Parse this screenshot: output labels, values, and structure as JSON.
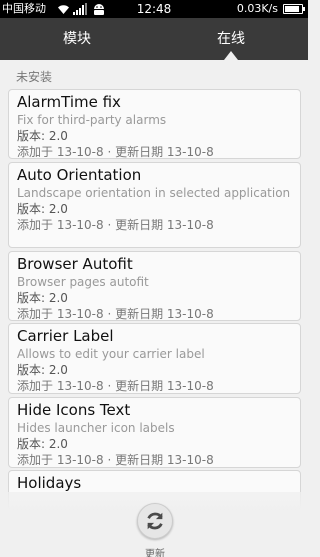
{
  "status_bar": {
    "carrier": "中国移动",
    "time": "12:48",
    "speed": "0.03K/s",
    "battery_level": 0.85
  },
  "tabs": [
    {
      "label": "模块"
    },
    {
      "label": "在线"
    }
  ],
  "section": {
    "title": "未安装"
  },
  "modules": [
    {
      "title": "AlarmTime fix",
      "description": "Fix for third-party alarms",
      "version": "版本: 2.0",
      "dates": "添加于 13-10-8 · 更新日期 13-10-8"
    },
    {
      "title": "Auto Orientation",
      "description": "Landscape orientation in selected application",
      "version": "版本: 2.0",
      "dates": "添加于 13-10-8 · 更新日期 13-10-8"
    },
    {
      "title": "Browser Autofit",
      "description": "Browser pages autofit",
      "version": "版本: 2.0",
      "dates": "添加于 13-10-8 · 更新日期 13-10-8"
    },
    {
      "title": "Carrier Label",
      "description": "Allows to edit your carrier label",
      "version": "版本: 2.0",
      "dates": "添加于 13-10-8 · 更新日期 13-10-8"
    },
    {
      "title": "Hide Icons Text",
      "description": "Hides launcher icon labels",
      "version": "版本: 2.0",
      "dates": "添加于 13-10-8 · 更新日期 13-10-8"
    },
    {
      "title": "Holidays"
    }
  ],
  "bottom_bar": {
    "refresh_label": "更新",
    "icon": "refresh-icon"
  },
  "colors": {
    "status_bar": "#000000",
    "tab_bar": "#3a3a3a",
    "background": "#f0f0f0",
    "card": "#fafafa"
  }
}
